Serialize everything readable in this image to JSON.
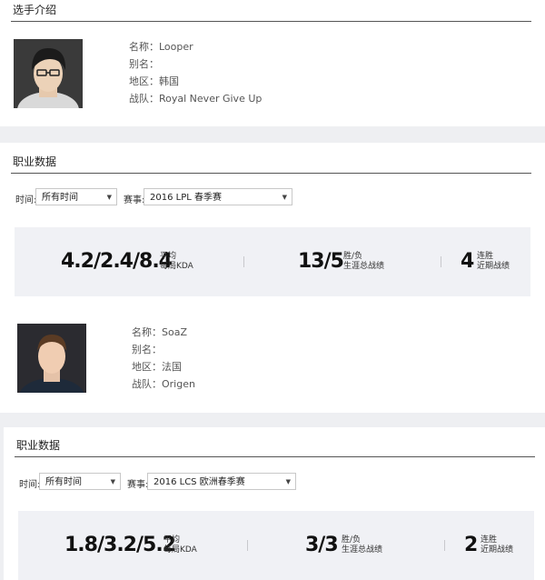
{
  "players": [
    {
      "section_profile": "选手介绍",
      "fields": [
        {
          "label": "名称：",
          "value": "Looper"
        },
        {
          "label": "别名：",
          "value": ""
        },
        {
          "label": "地区：",
          "value": "韩国"
        },
        {
          "label": "战队：",
          "value": "Royal Never Give Up"
        }
      ],
      "section_career": "职业数据",
      "time_label": "时间:",
      "time_value": "所有时间",
      "event_label": "赛事:",
      "event_value": "2016 LPL 春季赛",
      "kda": "4.2/2.4/8.4",
      "kda_label1": "平均",
      "kda_label2": "每局KDA",
      "record": "13/5",
      "record_label1": "胜/负",
      "record_label2": "生涯总战绩",
      "streak": "4",
      "streak_label1": "连胜",
      "streak_label2": "近期战绩"
    },
    {
      "fields": [
        {
          "label": "名称：",
          "value": "SoaZ"
        },
        {
          "label": "别名：",
          "value": ""
        },
        {
          "label": "地区：",
          "value": "法国"
        },
        {
          "label": "战队：",
          "value": "Origen"
        }
      ],
      "section_career": "职业数据",
      "time_label": "时间:",
      "time_value": "所有时间",
      "event_label": "赛事:",
      "event_value": "2016 LCS 欧洲春季赛",
      "kda": "1.8/3.2/5.2",
      "kda_label1": "平均",
      "kda_label2": "每局KDA",
      "record": "3/3",
      "record_label1": "胜/负",
      "record_label2": "生涯总战绩",
      "streak": "2",
      "streak_label1": "连胜",
      "streak_label2": "近期战绩"
    }
  ]
}
